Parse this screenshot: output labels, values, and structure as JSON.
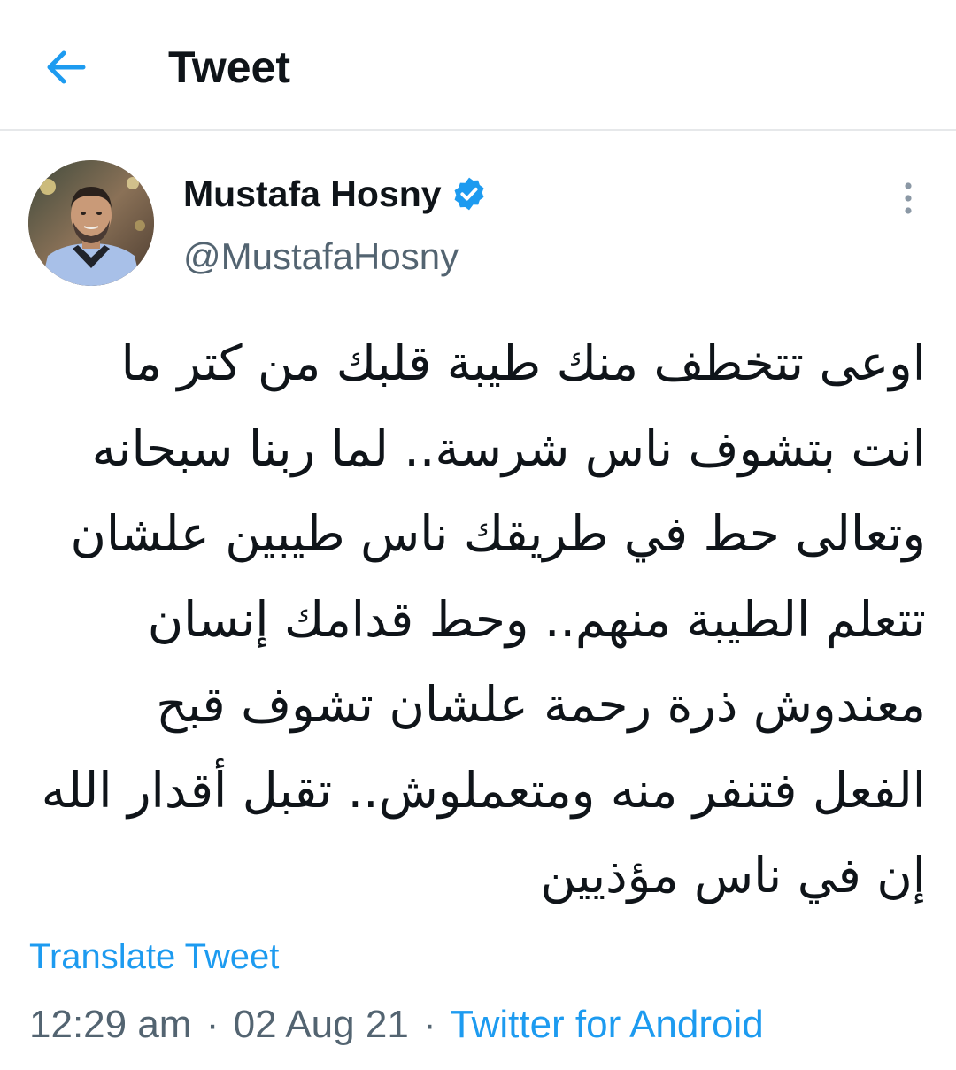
{
  "header": {
    "back_icon": "arrow-left-icon",
    "title": "Tweet"
  },
  "author": {
    "avatar_icon": "profile-photo",
    "name": "Mustafa Hosny",
    "verified_icon": "verified-badge-icon",
    "handle": "@MustafaHosny"
  },
  "menu": {
    "icon": "more-vertical-icon"
  },
  "tweet": {
    "lines": [
      "اوعى تتخطف منك طيبة قلبك من كتر ما",
      "انت بتشوف ناس شرسة.. لما ربنا سبحانه",
      "وتعالى حط في طريقك ناس طيبين علشان",
      "تتعلم الطيبة منهم.. وحط قدامك إنسان",
      "معندوش ذرة رحمة علشان تشوف قبح",
      "الفعل فتنفر منه ومتعملوش.. تقبل أقدار الله",
      "إن في ناس مؤذيين"
    ]
  },
  "translate_label": "Translate Tweet",
  "meta": {
    "time": "12:29 am",
    "separator": "·",
    "date": "02 Aug 21",
    "source": "Twitter for Android"
  },
  "colors": {
    "accent": "#1d9bf0",
    "text_primary": "#0f1419",
    "text_secondary": "#536471",
    "divider": "#e6e8ea"
  }
}
